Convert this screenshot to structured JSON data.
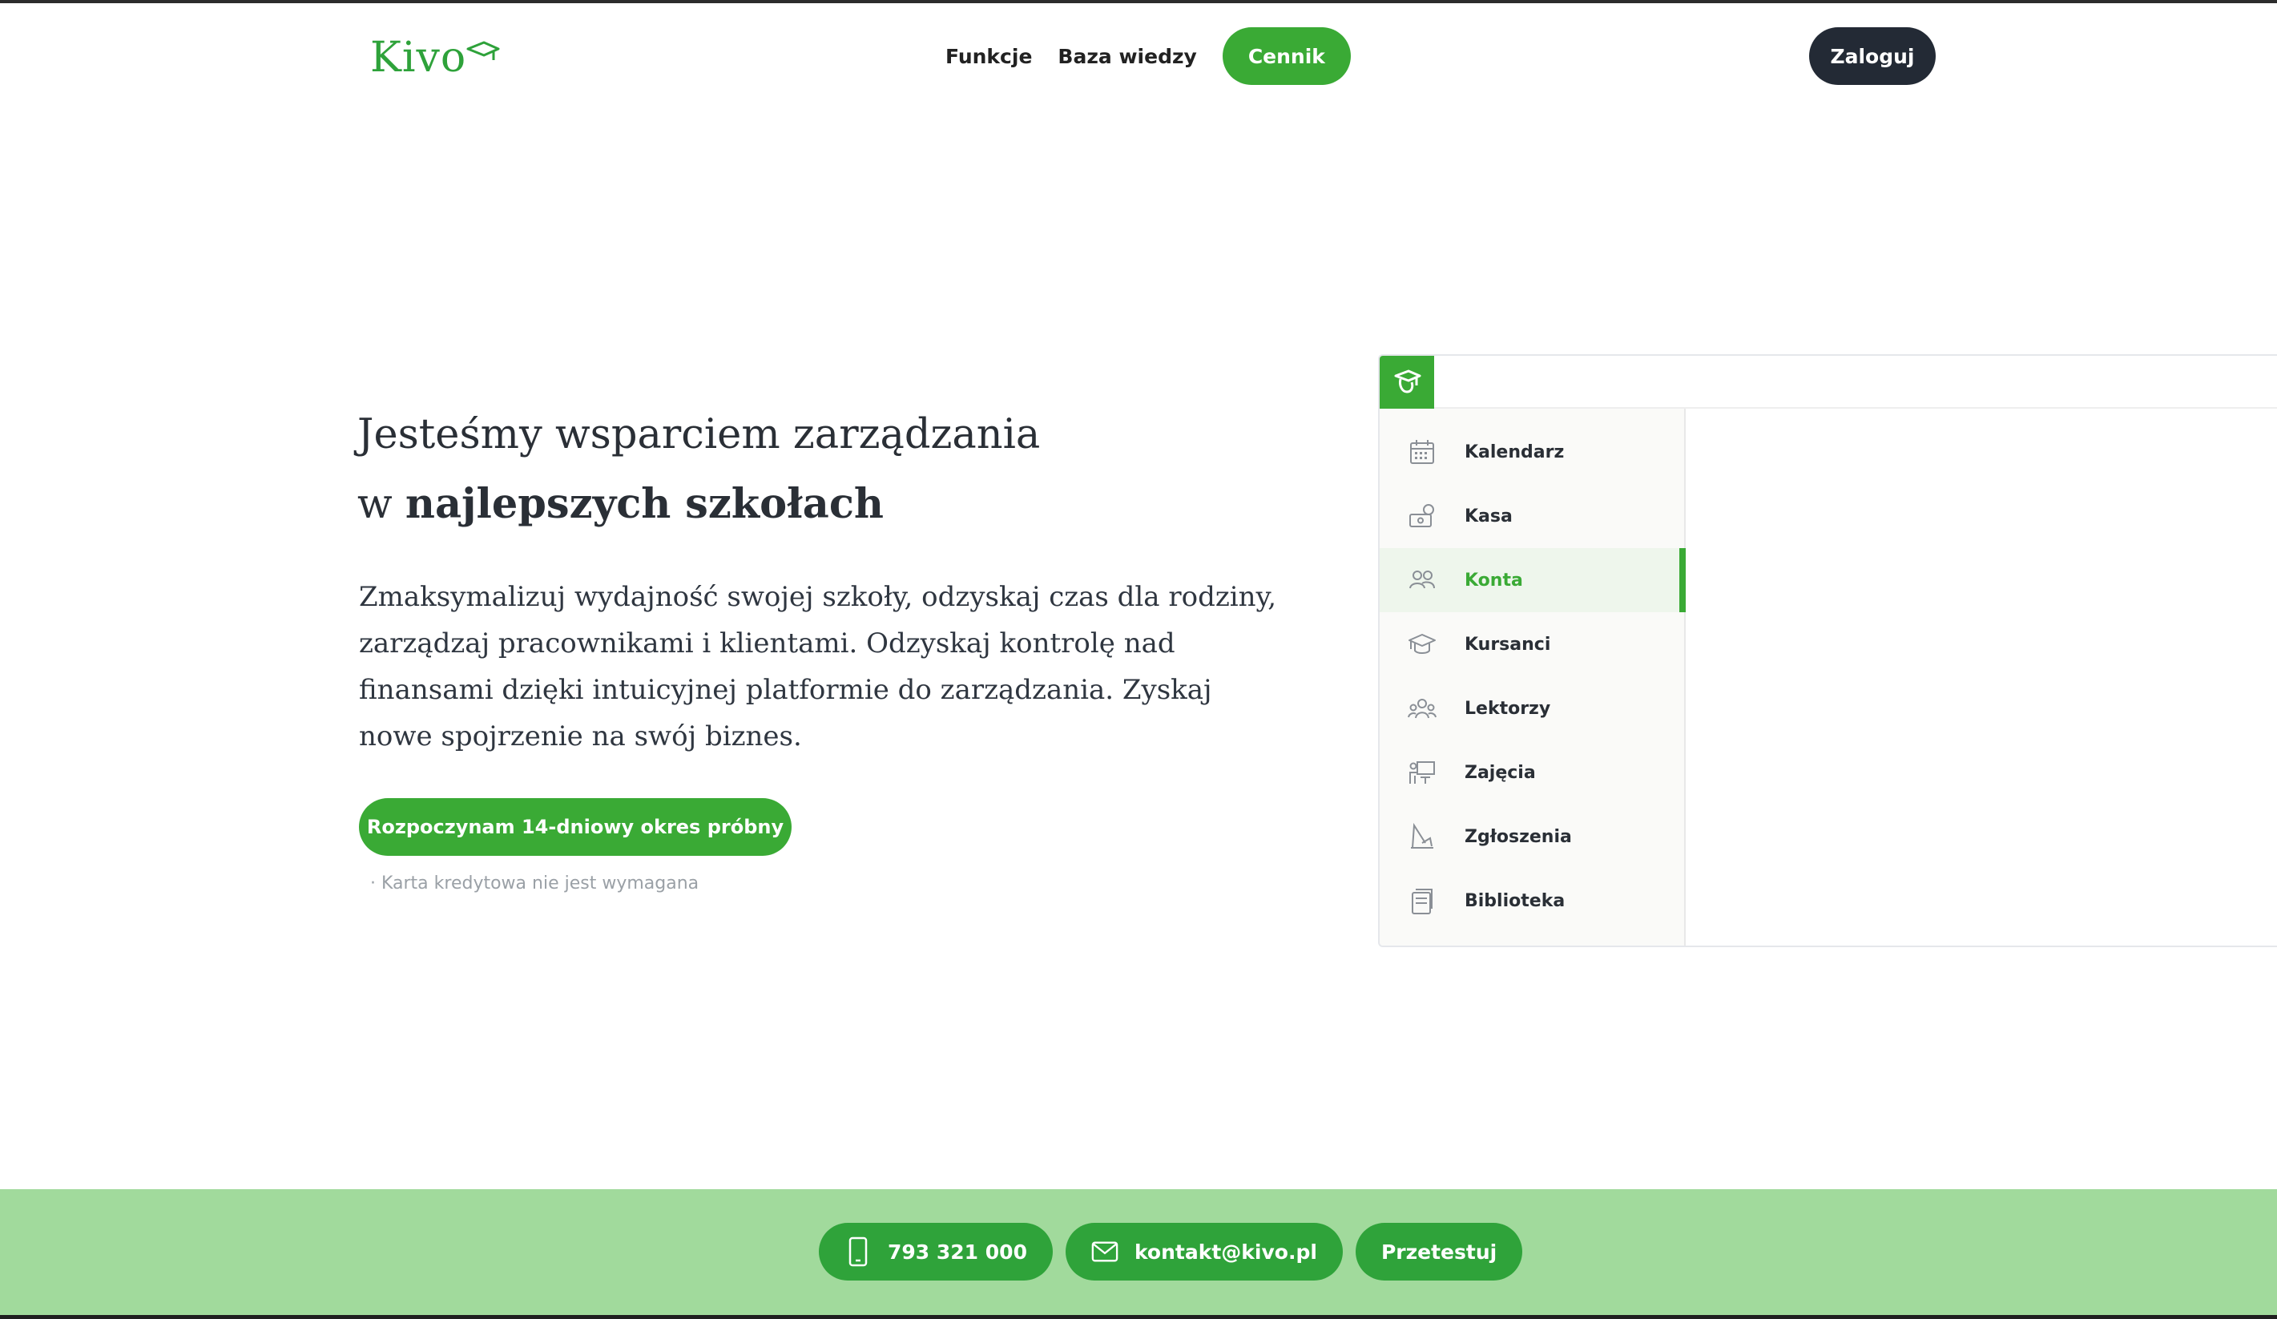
{
  "header": {
    "logo_text": "Kivo",
    "nav": {
      "features": "Funkcje",
      "knowledge_base": "Baza wiedzy",
      "pricing": "Cennik"
    },
    "login": "Zaloguj"
  },
  "hero": {
    "title_line1": "Jesteśmy wsparciem zarządzania",
    "title_line2_prefix": "w ",
    "title_line2_bold": "najlepszych szkołach",
    "description": "Zmaksymalizuj wydajność swojej szkoły, odzyskaj czas dla rodziny, zarządzaj pracownikami i klientami. Odzyskaj kontrolę nad finansami dzięki intuicyjnej platformie do zarządzania. Zyskaj nowe spojrzenie na swój biznes.",
    "cta": "Rozpoczynam 14-dniowy okres próbny",
    "note": "· Karta kredytowa nie jest wymagana"
  },
  "app_preview": {
    "menu": [
      {
        "label": "Kalendarz",
        "icon": "calendar-icon"
      },
      {
        "label": "Kasa",
        "icon": "cash-icon"
      },
      {
        "label": "Konta",
        "icon": "users-icon",
        "active": true
      },
      {
        "label": "Kursanci",
        "icon": "graduation-cap-icon"
      },
      {
        "label": "Lektorzy",
        "icon": "teachers-icon"
      },
      {
        "label": "Zajęcia",
        "icon": "classes-icon"
      },
      {
        "label": "Zgłoszenia",
        "icon": "requests-icon"
      },
      {
        "label": "Biblioteka",
        "icon": "library-icon"
      }
    ],
    "accent_color": "#3aaa35"
  },
  "footer": {
    "phone": "793 321 000",
    "email": "kontakt@kivo.pl",
    "try": "Przetestuj"
  },
  "colors": {
    "brand_green": "#3aaa35",
    "dark": "#232a35",
    "footer_bg": "#a1da9c"
  }
}
